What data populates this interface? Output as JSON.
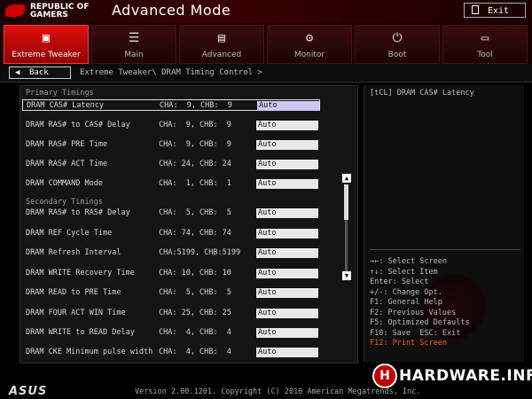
{
  "header": {
    "brand_line1": "REPUBLIC OF",
    "brand_line2": "GAMERS",
    "mode_title": "Advanced Mode",
    "exit_label": "Exit"
  },
  "tabs": [
    {
      "label": "Extreme Tweaker",
      "icon": "chip-icon",
      "glyph": "▣",
      "active": true
    },
    {
      "label": "Main",
      "icon": "list-icon",
      "glyph": "☰",
      "active": false
    },
    {
      "label": "Advanced",
      "icon": "advanced-icon",
      "glyph": "▤",
      "active": false
    },
    {
      "label": "Monitor",
      "icon": "monitor-icon",
      "glyph": "⚙",
      "active": false
    },
    {
      "label": "Boot",
      "icon": "power-icon",
      "glyph": "⏻",
      "active": false
    },
    {
      "label": "Tool",
      "icon": "toolbox-icon",
      "glyph": "▭",
      "active": false
    }
  ],
  "nav": {
    "back_label": "Back",
    "breadcrumb": "Extreme Tweaker\\ DRAM Timing Control >"
  },
  "sections": {
    "primary": "Primary Timings",
    "secondary": "Secondary Timings"
  },
  "rows": [
    {
      "name": "DRAM CAS# Latency",
      "value": "CHA:  9, CHB:  9",
      "setting": "Auto",
      "selected": true
    },
    {
      "name": "DRAM RAS# to CAS# Delay",
      "value": "CHA:  9, CHB:  9",
      "setting": "Auto"
    },
    {
      "name": "DRAM RAS# PRE Time",
      "value": "CHA:  9, CHB:  9",
      "setting": "Auto"
    },
    {
      "name": "DRAM RAS# ACT Time",
      "value": "CHA: 24, CHB: 24",
      "setting": "Auto"
    },
    {
      "name": "DRAM COMMAND Mode",
      "value": "CHA:  1, CHB:  1",
      "setting": "Auto"
    },
    {
      "name": "DRAM RAS# to RAS# Delay",
      "value": "CHA:  5, CHB:  5",
      "setting": "Auto"
    },
    {
      "name": "DRAM REF Cycle Time",
      "value": "CHA: 74, CHB: 74",
      "setting": "Auto"
    },
    {
      "name": "DRAM Refresh Interval",
      "value": "CHA:5199, CHB:5199",
      "setting": "Auto"
    },
    {
      "name": "DRAM WRITE Recovery Time",
      "value": "CHA: 10, CHB: 10",
      "setting": "Auto"
    },
    {
      "name": "DRAM READ to PRE Time",
      "value": "CHA:  5, CHB:  5",
      "setting": "Auto"
    },
    {
      "name": "DRAM FOUR ACT WIN Time",
      "value": "CHA: 25, CHB: 25",
      "setting": "Auto"
    },
    {
      "name": "DRAM WRITE to READ Delay",
      "value": "CHA:  4, CHB:  4",
      "setting": "Auto"
    },
    {
      "name": "DRAM CKE Minimum pulse width",
      "value": "CHA:  4, CHB:  4",
      "setting": "Auto"
    }
  ],
  "help": {
    "description": "[tCL] DRAM CAS# Latency",
    "keys": [
      {
        "text": "→←: Select Screen"
      },
      {
        "text": "↑↓: Select Item"
      },
      {
        "text": "Enter: Select"
      },
      {
        "text": "+/-: Change Opt."
      },
      {
        "text": "F1: General Help"
      },
      {
        "text": "F2: Previous Values"
      },
      {
        "text": "F5: Optimized Defaults"
      },
      {
        "text": "F10: Save  ESC: Exit"
      },
      {
        "text": "F12: Print Screen",
        "highlight": true
      }
    ]
  },
  "footer": {
    "brand": "ASUS",
    "version": "Version 2.00.1201. Copyright (C) 2010 American Megatrends, Inc."
  },
  "watermark": {
    "letter": "H",
    "text": "HARDWARE.INFO"
  },
  "colors": {
    "accent_red": "#cc0000",
    "highlight_orange": "#ff5a2a"
  }
}
